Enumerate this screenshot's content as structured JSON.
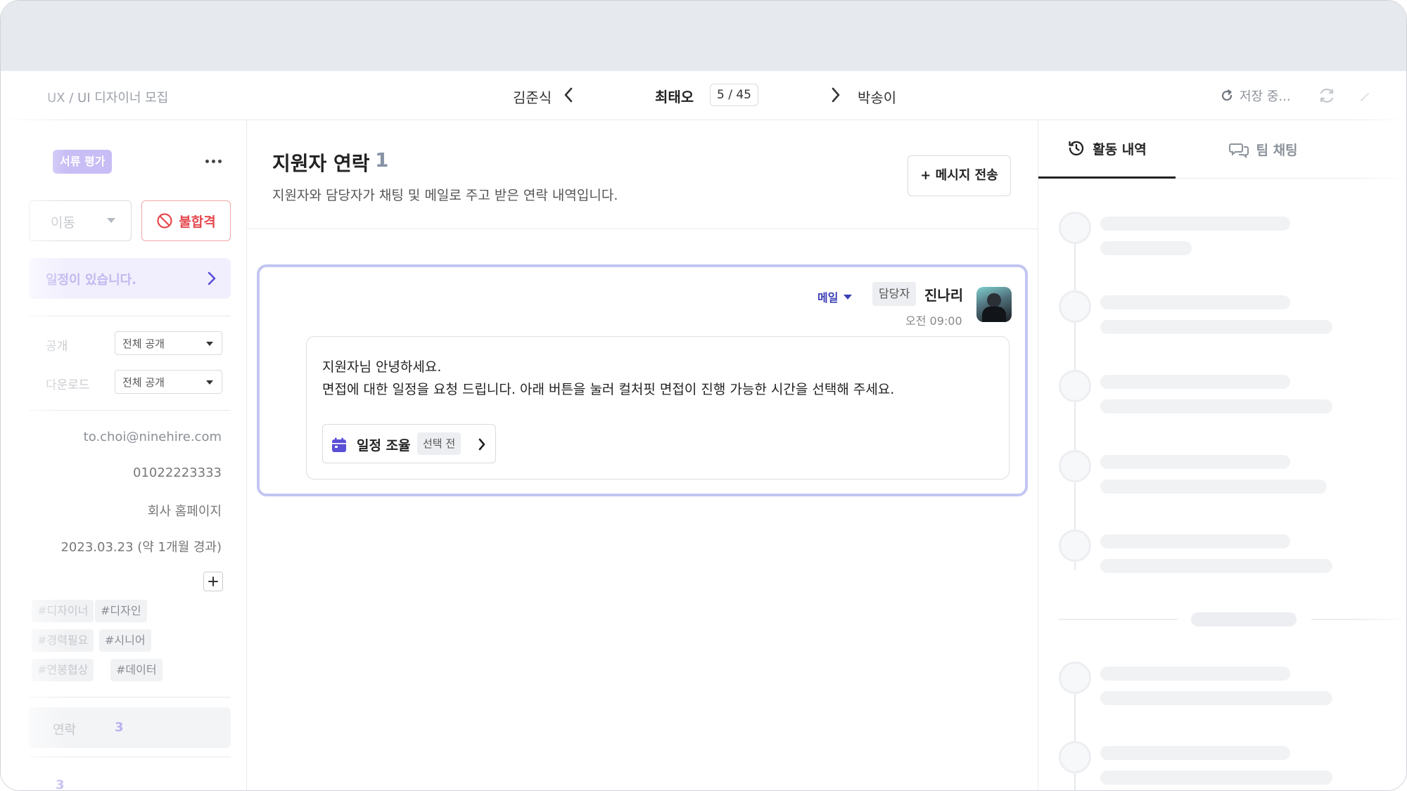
{
  "header": {
    "breadcrumb": "UX / UI 디자이너 모집",
    "prev_applicant": "김준식",
    "current_applicant": "최태오",
    "position_count": "5 / 45",
    "next_applicant": "박송이",
    "save_status": "저장 중..."
  },
  "sidebar": {
    "stage_badge": "서류 평가",
    "move_select_value": "이동",
    "reject_label": "불합격",
    "schedule_banner": "일정이 있습니다.",
    "settings": [
      {
        "label": "공개",
        "value": "전체 공개"
      },
      {
        "label": "다운로드",
        "value": "전체 공개"
      }
    ],
    "email": "to.choi@ninehire.com",
    "phone": "01022223333",
    "source": "회사 홈페이지",
    "applied_date": "2023.03.23 (약 1개월 경과)",
    "tags": [
      "#디자이너",
      "#디자인",
      "#경력필요",
      "#시니어",
      "#연봉협상",
      "#데이터"
    ],
    "contact_label": "연락",
    "contact_count": "3",
    "bottom_count": "3"
  },
  "main": {
    "title": "지원자 연락",
    "count": "1",
    "description": "지원자와 담당자가 채팅 및 메일로 주고 받은 연락 내역입니다.",
    "send_button": "+ 메시지 전송",
    "message": {
      "channel": "메일",
      "role": "담당자",
      "sender": "진나리",
      "time": "오전 09:00",
      "line1": "지원자님 안녕하세요.",
      "line2": "면접에 대한 일정을 요청 드립니다. 아래 버튼을 눌러 컬처핏 면접이 진행 가능한 시간을 선택해 주세요.",
      "schedule_button": "일정 조율",
      "schedule_state": "선택 전"
    }
  },
  "right_panel": {
    "tab_activity": "활동 내역",
    "tab_chat": "팀 채팅"
  },
  "colors": {
    "accent": "#3b3fb5",
    "reject": "#e5484d",
    "card_border": "#c3c6f2",
    "stage_badge": "#c8bdf5"
  }
}
